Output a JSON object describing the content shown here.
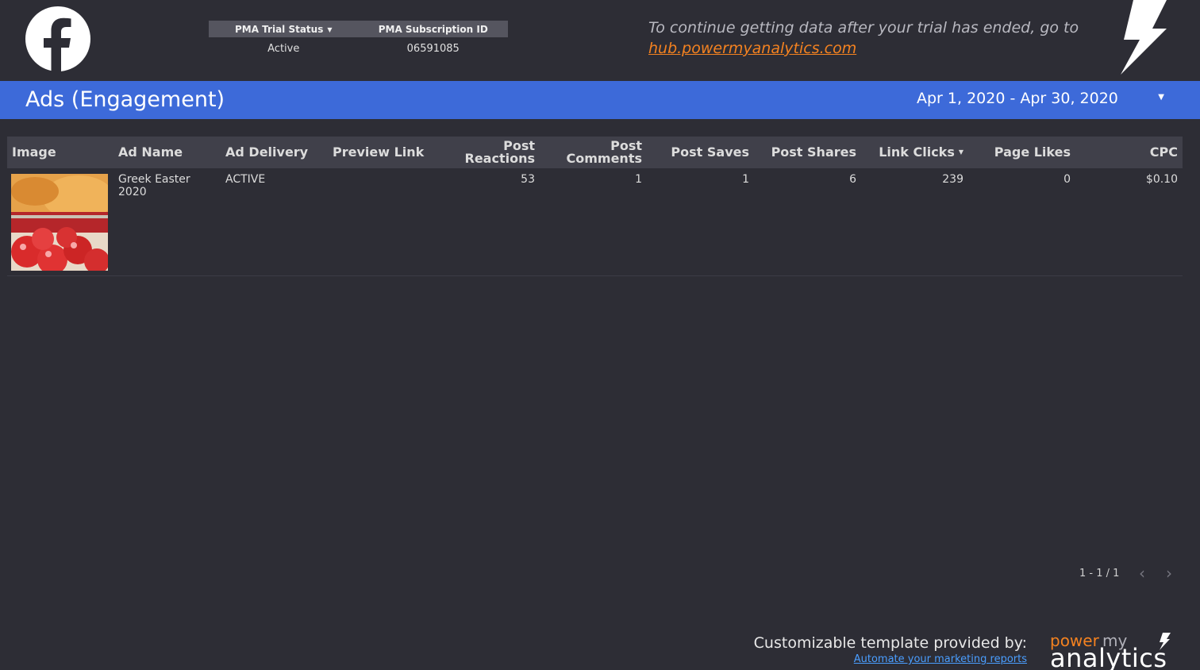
{
  "header": {
    "pma_table": {
      "columns": [
        "PMA Trial Status",
        "PMA Subscription ID"
      ],
      "values": [
        "Active",
        "06591085"
      ]
    },
    "trial_message": "To continue getting data after your trial has ended, go to",
    "trial_link": "hub.powermyanalytics.com"
  },
  "titlebar": {
    "title": "Ads (Engagement)",
    "date_range": "Apr 1, 2020 - Apr 30, 2020"
  },
  "table": {
    "columns": {
      "image": "Image",
      "ad_name": "Ad Name",
      "ad_delivery": "Ad Delivery",
      "preview_link": "Preview Link",
      "post_reactions": "Post Reactions",
      "post_comments_1": "Post",
      "post_comments_2": "Comments",
      "post_saves": "Post Saves",
      "post_shares": "Post Shares",
      "link_clicks": "Link Clicks",
      "page_likes": "Page Likes",
      "cpc": "CPC"
    },
    "rows": [
      {
        "ad_name": "Greek Easter 2020",
        "ad_delivery": "ACTIVE",
        "preview_link": "",
        "post_reactions": "53",
        "post_comments": "1",
        "post_saves": "1",
        "post_shares": "6",
        "link_clicks": "239",
        "page_likes": "0",
        "cpc": "$0.10"
      }
    ]
  },
  "pager": {
    "range": "1 - 1 / 1"
  },
  "footer": {
    "provided_by": "Customizable template provided by:",
    "link": "Automate your marketing reports",
    "brand_power": "power",
    "brand_my": "my",
    "brand_analytics": "analytics"
  },
  "colors": {
    "background": "#2d2d35",
    "accent_blue": "#3d6ad9",
    "link_orange": "#f48220",
    "link_blue": "#4a9eff"
  },
  "icons": [
    "facebook-logo-icon",
    "lightning-bolt-icon",
    "caret-down-icon",
    "chevron-left-icon",
    "chevron-right-icon"
  ]
}
